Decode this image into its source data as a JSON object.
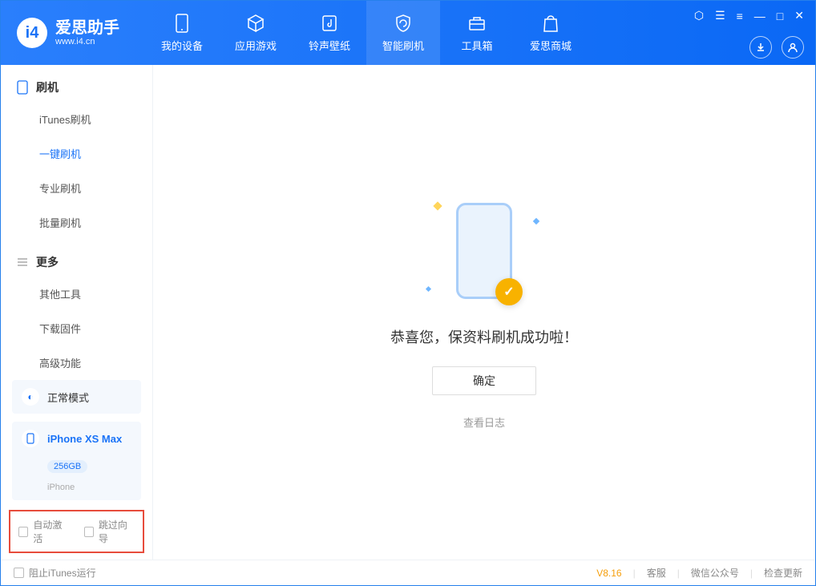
{
  "app": {
    "name": "爱思助手",
    "url": "www.i4.cn"
  },
  "nav": {
    "items": [
      {
        "label": "我的设备"
      },
      {
        "label": "应用游戏"
      },
      {
        "label": "铃声壁纸"
      },
      {
        "label": "智能刷机"
      },
      {
        "label": "工具箱"
      },
      {
        "label": "爱思商城"
      }
    ]
  },
  "sidebar": {
    "section1": {
      "title": "刷机",
      "items": [
        "iTunes刷机",
        "一键刷机",
        "专业刷机",
        "批量刷机"
      ]
    },
    "section2": {
      "title": "更多",
      "items": [
        "其他工具",
        "下载固件",
        "高级功能"
      ]
    }
  },
  "mode_card": {
    "label": "正常模式"
  },
  "device_card": {
    "name": "iPhone XS Max",
    "storage": "256GB",
    "type": "iPhone"
  },
  "bottom_checks": {
    "auto_activate": "自动激活",
    "skip_guide": "跳过向导"
  },
  "main": {
    "success_message": "恭喜您，保资料刷机成功啦！",
    "ok_button": "确定",
    "view_log": "查看日志"
  },
  "statusbar": {
    "block_itunes": "阻止iTunes运行",
    "version": "V8.16",
    "support": "客服",
    "wechat": "微信公众号",
    "check_update": "检查更新"
  }
}
